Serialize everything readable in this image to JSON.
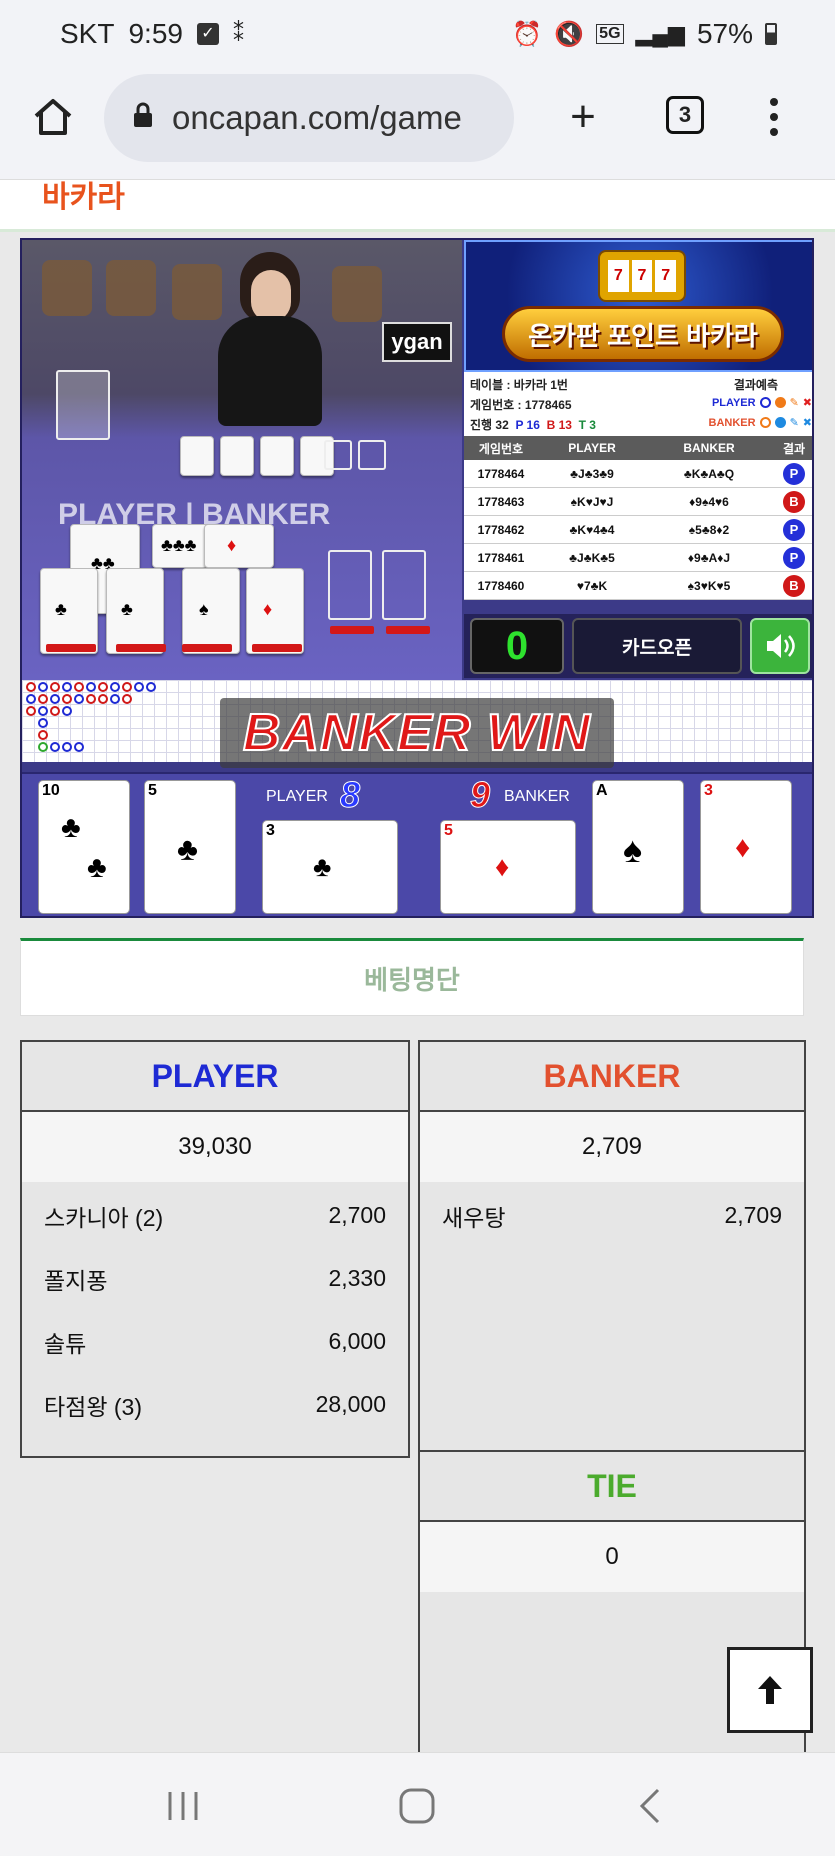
{
  "status_bar": {
    "carrier": "SKT",
    "time": "9:59",
    "network": "5G",
    "battery": "57%"
  },
  "browser": {
    "url": "oncapan.com/game",
    "tab_count": "3"
  },
  "site": {
    "logo_text": "바카라"
  },
  "game": {
    "overlay_label": "ygan",
    "table_label_player": "PLAYER",
    "table_label_banker": "BANKER",
    "banner_title": "온카판 포인트 바카라",
    "slot_symbols": [
      "7",
      "7",
      "7"
    ],
    "table_info": "테이블 : 바카라 1번",
    "game_number_label": "게임번호 : 1778465",
    "progress": "진행 32",
    "p_count": "P 16",
    "b_count": "B 13",
    "t_count": "T 3",
    "prediction_label": "결과예측",
    "prediction_player": "PLAYER",
    "prediction_banker": "BANKER",
    "history_headers": [
      "게임번호",
      "PLAYER",
      "BANKER",
      "결과"
    ],
    "history": [
      {
        "no": "1778464",
        "player": "♣J♣3♣9",
        "banker": "♣K♣A♣Q",
        "result": "P",
        "type": "p"
      },
      {
        "no": "1778463",
        "player": "♠K♥J♥J",
        "banker": "♦9♠4♥6",
        "result": "B",
        "type": "b"
      },
      {
        "no": "1778462",
        "player": "♣K♥4♣4",
        "banker": "♠5♣8♦2",
        "result": "P",
        "type": "p"
      },
      {
        "no": "1778461",
        "player": "♣J♣K♣5",
        "banker": "♦9♣A♦J",
        "result": "P",
        "type": "p"
      },
      {
        "no": "1778460",
        "player": "♥7♣K",
        "banker": "♠3♥K♥5",
        "result": "B",
        "type": "b"
      }
    ],
    "counter": "0",
    "card_open_label": "카드오픈",
    "win_text": "BANKER WIN",
    "player_score_label": "PLAYER",
    "player_score": "8",
    "banker_score_label": "BANKER",
    "banker_score": "9",
    "player_cards": [
      {
        "rank": "10",
        "suit": "♣"
      },
      {
        "rank": "5",
        "suit": "♣"
      },
      {
        "rank": "3",
        "suit": "♣"
      }
    ],
    "banker_cards": [
      {
        "rank": "5",
        "suit": "♦"
      },
      {
        "rank": "A",
        "suit": "♠"
      },
      {
        "rank": "3",
        "suit": "♦"
      }
    ]
  },
  "betting": {
    "title": "베팅명단",
    "player": {
      "label": "PLAYER",
      "total": "39,030",
      "rows": [
        {
          "name": "스카니아 (2)",
          "amount": "2,700"
        },
        {
          "name": "폴지퐁",
          "amount": "2,330"
        },
        {
          "name": "솔튜",
          "amount": "6,000"
        },
        {
          "name": "타점왕 (3)",
          "amount": "28,000"
        }
      ]
    },
    "banker": {
      "label": "BANKER",
      "total": "2,709",
      "rows": [
        {
          "name": "새우탕",
          "amount": "2,709"
        }
      ]
    },
    "tie": {
      "label": "TIE",
      "total": "0"
    }
  },
  "colors": {
    "player_blue": "#1e2ad4",
    "banker_red": "#e2512f",
    "tie_green": "#4bab2d",
    "accent_green": "#1a8a3c"
  }
}
